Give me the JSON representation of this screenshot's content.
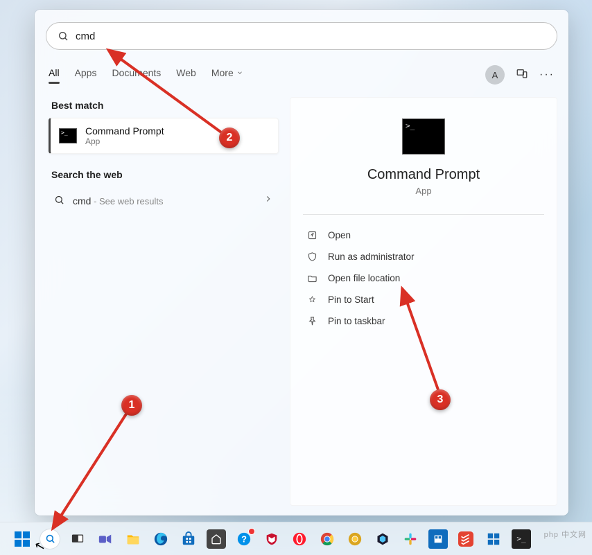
{
  "search": {
    "value": "cmd"
  },
  "tabs": {
    "all": "All",
    "apps": "Apps",
    "documents": "Documents",
    "web": "Web",
    "more": "More"
  },
  "avatar": {
    "initial": "A"
  },
  "left": {
    "best_match_title": "Best match",
    "result": {
      "title": "Command Prompt",
      "subtitle": "App"
    },
    "search_web_title": "Search the web",
    "web_item": {
      "query": "cmd",
      "hint": " - See web results"
    }
  },
  "right": {
    "title": "Command Prompt",
    "subtitle": "App",
    "actions": {
      "open": "Open",
      "admin": "Run as administrator",
      "location": "Open file location",
      "pin_start": "Pin to Start",
      "pin_taskbar": "Pin to taskbar"
    }
  },
  "annotations": {
    "a1": "1",
    "a2": "2",
    "a3": "3"
  },
  "watermark": "php 中文网"
}
